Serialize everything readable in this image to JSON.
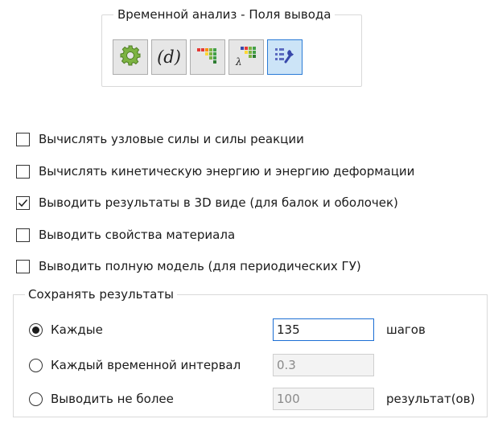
{
  "output_group": {
    "title": "Временной анализ - Поля вывода",
    "tools": [
      {
        "icon": "gear-icon"
      },
      {
        "icon": "displacement-icon",
        "label": "(d)"
      },
      {
        "icon": "field-grid-icon"
      },
      {
        "icon": "lambda-grid-icon"
      },
      {
        "icon": "settings-list-icon",
        "active": true
      }
    ]
  },
  "options": [
    {
      "label": "Вычислять узловые силы и силы реакции",
      "checked": false
    },
    {
      "label": "Вычислять кинетическую энергию и энергию деформации",
      "checked": false
    },
    {
      "label": "Выводить результаты в 3D виде (для балок и оболочек)",
      "checked": true
    },
    {
      "label": "Выводить свойства материала",
      "checked": false
    },
    {
      "label": "Выводить полную модель (для периодических ГУ)",
      "checked": false
    }
  ],
  "save_results": {
    "title": "Сохранять результаты",
    "modes": [
      {
        "label": "Каждые",
        "value": "135",
        "unit": "шагов",
        "selected": true
      },
      {
        "label": "Каждый временной интервал",
        "value": "0.3",
        "unit": "",
        "selected": false
      },
      {
        "label": "Выводить не более",
        "value": "100",
        "unit": "результат(ов)",
        "selected": false
      }
    ]
  },
  "colors": {
    "accent": "#2b7bd6",
    "active_bg": "#cce4f7",
    "button_bg": "#e6e6e6"
  }
}
